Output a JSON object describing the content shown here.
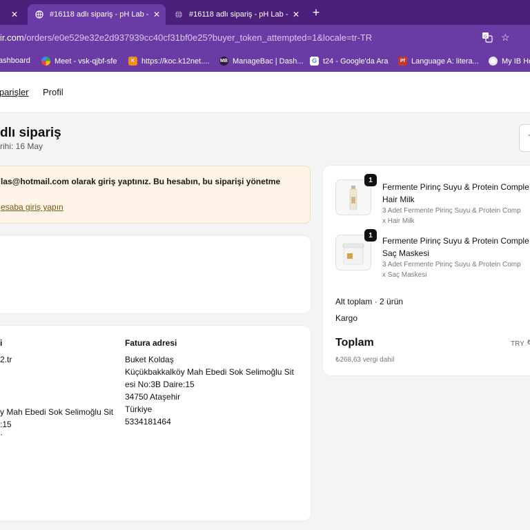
{
  "browser": {
    "tabs": [
      {
        "title": "",
        "active": false
      },
      {
        "title": "#16118 adlı sipariş - pH Lab -",
        "active": true
      },
      {
        "title": "#16118 adlı sipariş - pH Lab -",
        "active": false
      }
    ],
    "new_tab_label": "+",
    "url_domain": "ir.com",
    "url_path": "/orders/e0e529e32e2d937939cc40cf31bf0e25?buyer_token_attempted=1&locale=tr-TR",
    "bookmarks": [
      {
        "label": "ashboard",
        "icon": "dashboard-icon"
      },
      {
        "label": "Meet - vsk-qjbf-sfe",
        "icon": "meet-icon"
      },
      {
        "label": "https://koc.k12net....",
        "icon": "k12net-icon"
      },
      {
        "label": "ManageBac | Dash...",
        "icon": "managebac-icon",
        "badge": "MB"
      },
      {
        "label": "t24 - Google'da Ara",
        "icon": "google-icon"
      },
      {
        "label": "Language A: litera...",
        "icon": "pf-icon",
        "badge": "Pf"
      },
      {
        "label": "My IB Ho",
        "icon": "ib-icon"
      }
    ]
  },
  "nav": {
    "orders": "iparişler",
    "profile": "Profil"
  },
  "order": {
    "title": "dlı sipariş",
    "date": "rihi: 16 May",
    "top_button": "T"
  },
  "notice": {
    "text": "las@hotmail.com olarak giriş yaptınız. Bu hesabın, bu siparişi yönetme",
    "link": "esaba giriş yapın"
  },
  "addresses": {
    "shipping": {
      "heading": "i",
      "email": "2.tr",
      "line_a": "y Mah Ebedi Sok Selimoğlu Sit",
      "line_b": ":15",
      "line_c": "·"
    },
    "billing": {
      "heading": "Fatura adresi",
      "lines": [
        "Buket Koldaş",
        "Küçükbakkalköy Mah Ebedi Sok Selimoğlu Sit",
        "esi No:3B Daire:15",
        "34750 Ataşehir",
        "Türkiye",
        "5334181464"
      ]
    }
  },
  "summary": {
    "items": [
      {
        "qty": "1",
        "name_line1": "Fermente Pirinç Suyu & Protein Comple",
        "name_line2": "Hair Milk",
        "sub_line1": "3 Adet Fermente Pirinç Suyu & Protein Comp",
        "sub_line2": "x Hair Milk"
      },
      {
        "qty": "1",
        "name_line1": "Fermente Pirinç Suyu & Protein Comple",
        "name_line2": "Saç Maskesi",
        "sub_line1": "3 Adet Fermente Pirinç Suyu & Protein Comp",
        "sub_line2": "x Saç Maskesi"
      }
    ],
    "subtotal_label": "Alt toplam · 2 ürün",
    "shipping_label": "Kargo",
    "total_label": "Toplam",
    "currency": "TRY",
    "currency_tail": "₺",
    "tax_note": "₺268,63 vergi dahil"
  }
}
